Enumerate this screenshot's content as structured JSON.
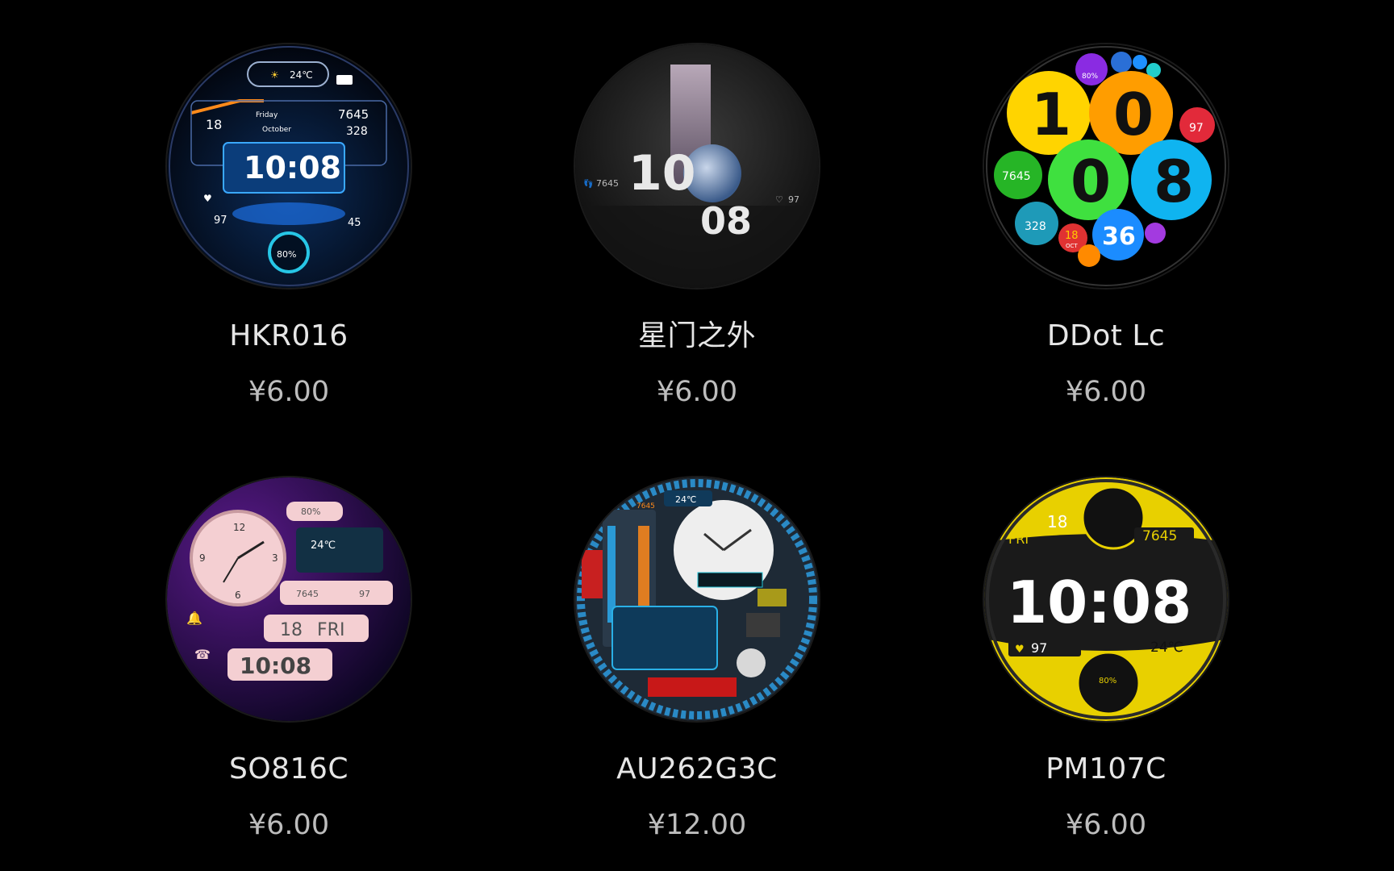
{
  "watchfaces": [
    {
      "name": "HKR016",
      "price": "¥6.00",
      "time": "10:08",
      "temp": "24℃",
      "steps": "7645",
      "kcal": "328",
      "date": "18",
      "day": "Friday",
      "month": "October",
      "heart": "97",
      "battery": "80%",
      "extra": "45"
    },
    {
      "name": "星门之外",
      "price": "¥6.00",
      "hour": "10",
      "minute": "08",
      "steps": "7645",
      "heart": "97"
    },
    {
      "name": "DDot Lc",
      "price": "¥6.00",
      "h1": "1",
      "h2": "0",
      "m1": "0",
      "m2": "8",
      "steps": "7645",
      "kcal": "328",
      "heart": "97",
      "sec": "36",
      "date": "18",
      "month": "OCT",
      "battery": "80%"
    },
    {
      "name": "SO816C",
      "price": "¥6.00",
      "battery": "80%",
      "temp": "24℃",
      "steps": "7645",
      "heart": "97",
      "date": "18",
      "day": "FRI",
      "time": "10:08"
    },
    {
      "name": "AU262G3C",
      "price": "¥12.00",
      "temp": "24℃",
      "steps": "7645"
    },
    {
      "name": "PM107C",
      "price": "¥6.00",
      "date": "18",
      "day": "FRI",
      "steps": "7645",
      "time": "10:08",
      "heart": "97",
      "temp": "24℃",
      "battery": "80%"
    }
  ]
}
